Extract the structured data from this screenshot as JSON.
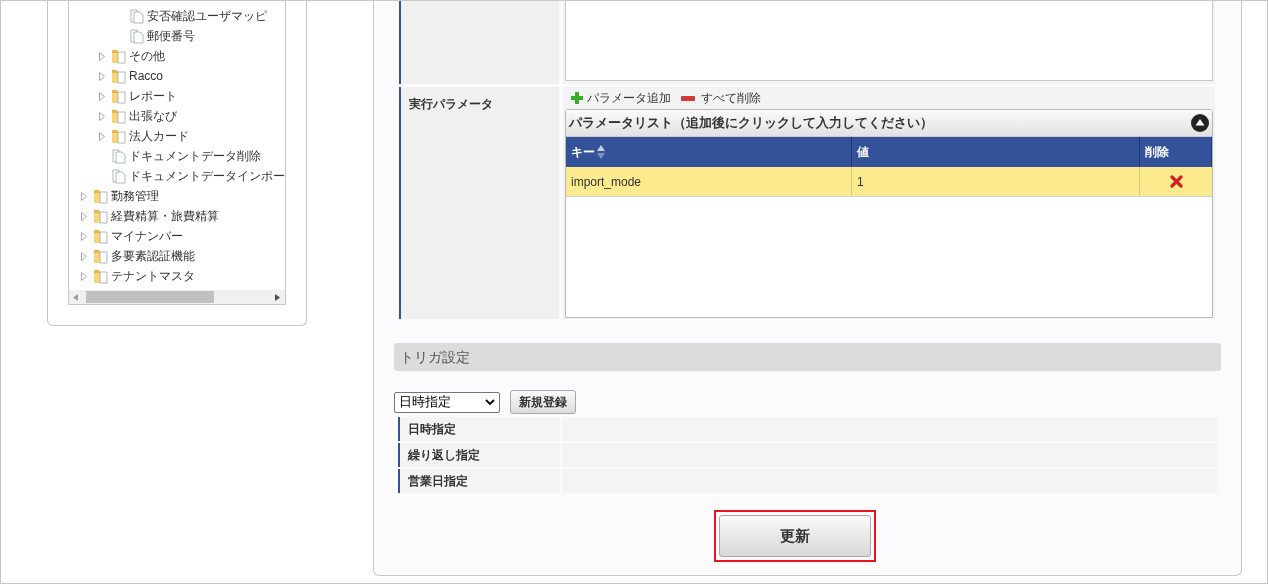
{
  "tree": {
    "items": [
      {
        "children": [
          {
            "children": [
              {
                "label": "安否確認ユーザマッピ",
                "kind": "doc"
              },
              {
                "label": "郵便番号",
                "kind": "doc"
              }
            ]
          },
          {
            "label": "その他",
            "kind": "folder",
            "expanded": false
          },
          {
            "label": "Racco",
            "kind": "folder",
            "expanded": false
          },
          {
            "label": "レポート",
            "kind": "folder",
            "expanded": false
          },
          {
            "label": "出張なび",
            "kind": "folder",
            "expanded": false
          },
          {
            "label": "法人カード",
            "kind": "folder",
            "expanded": false
          },
          {
            "label": "ドキュメントデータ削除",
            "kind": "doc"
          },
          {
            "label": "ドキュメントデータインポー",
            "kind": "doc"
          }
        ]
      },
      {
        "label": "勤務管理",
        "kind": "folder",
        "expanded": false
      },
      {
        "label": "経費精算・旅費精算",
        "kind": "folder",
        "expanded": false
      },
      {
        "label": "マイナンバー",
        "kind": "folder",
        "expanded": false
      },
      {
        "label": "多要素認証機能",
        "kind": "folder",
        "expanded": false
      },
      {
        "label": "テナントマスタ",
        "kind": "folder",
        "expanded": false
      }
    ]
  },
  "form": {
    "params_label": "実行パラメータ",
    "add_link": "パラメータ追加",
    "clear_link": "すべて削除",
    "param_list": {
      "title": "パラメータリスト（追加後にクリックして入力してください）",
      "columns": [
        "キー",
        "値",
        "削除"
      ],
      "rows": [
        {
          "key": "import_mode",
          "value": "1",
          "selected": true
        }
      ]
    }
  },
  "trigger": {
    "title": "トリガ設定",
    "select_value": "日時指定",
    "register_button": "新規登録",
    "rows": [
      "日時指定",
      "繰り返し指定",
      "営業日指定"
    ]
  },
  "update_button": "更新"
}
